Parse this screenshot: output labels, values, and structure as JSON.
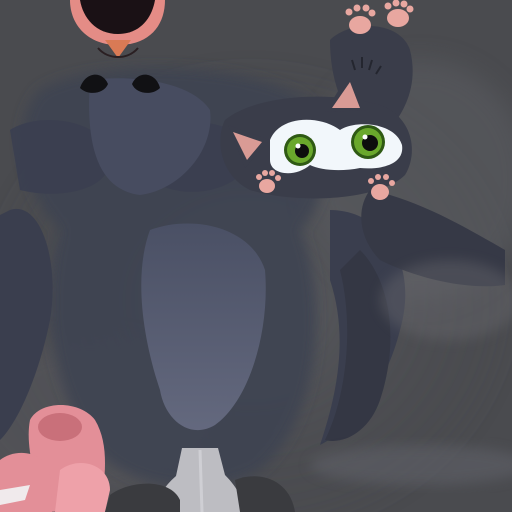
{
  "scene": {
    "description_name": "game-scene",
    "colors": {
      "background": "#4a4b4f",
      "fog": "#5c5d61",
      "body_dark": "#3d4150",
      "body_mid": "#4d5365",
      "belly": "#5b6178",
      "kitten_fur": "#3a3d4a",
      "ear_pink": "#d99b95",
      "paw_pink": "#e8a7a0",
      "eye_green": "#5c9a25",
      "eye_white": "#f2f7fb",
      "mouth_dark": "#1a1115",
      "mouth_lip": "#e48c86",
      "nose": "#d97a55",
      "boot_pink": "#e38f98",
      "boot_white": "#f0eaec",
      "bottle": "#bdbdc2"
    },
    "icons": [
      "cat-mouth-icon",
      "cat-nostrils-icon",
      "kitten-face-icon",
      "paw-print-icon",
      "boot-icon",
      "bottle-icon"
    ]
  }
}
